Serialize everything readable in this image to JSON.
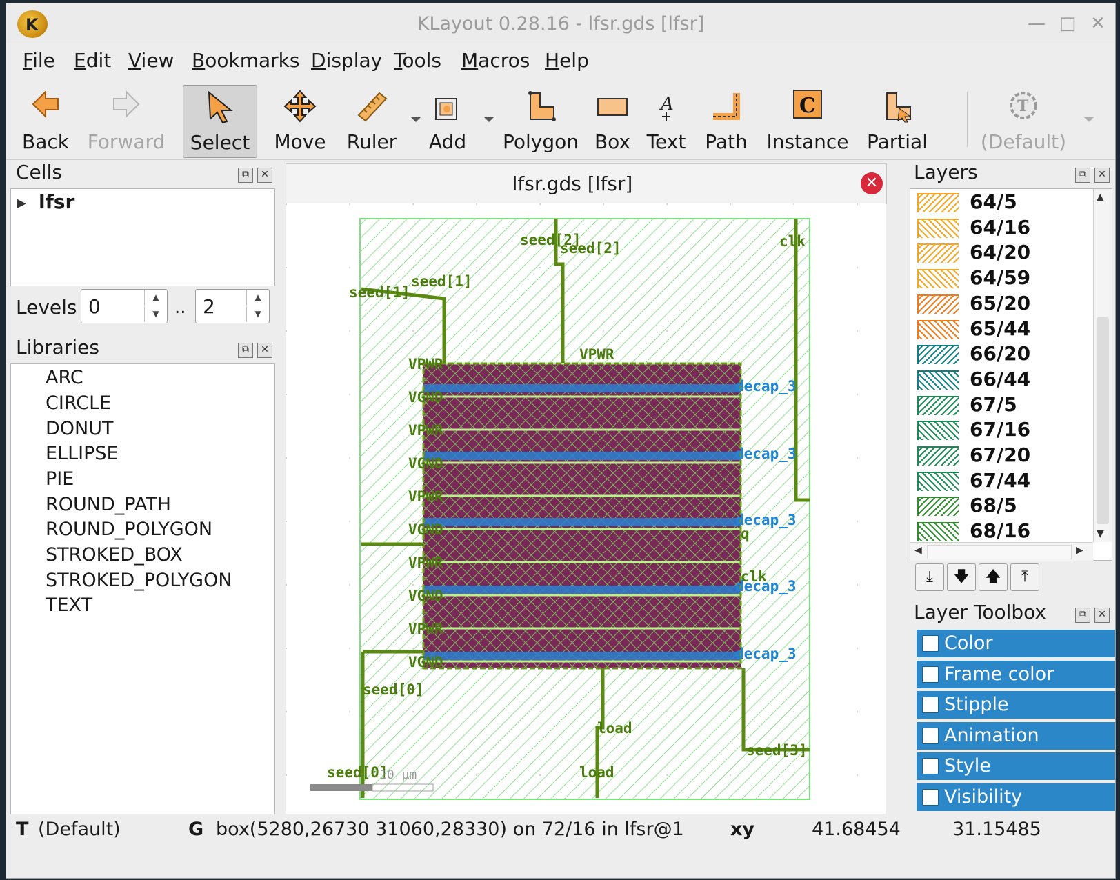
{
  "window": {
    "title": "KLayout 0.28.16 - lfsr.gds [lfsr]",
    "logo_letter": "K"
  },
  "menu": [
    {
      "label": "File",
      "u": "F",
      "rest": "ile"
    },
    {
      "label": "Edit",
      "u": "E",
      "rest": "dit"
    },
    {
      "label": "View",
      "u": "V",
      "rest": "iew"
    },
    {
      "label": "Bookmarks",
      "u": "B",
      "rest": "ookmarks"
    },
    {
      "label": "Display",
      "u": "D",
      "rest": "isplay"
    },
    {
      "label": "Tools",
      "u": "T",
      "rest": "ools"
    },
    {
      "label": "Macros",
      "u": "M",
      "rest": "acros"
    },
    {
      "label": "Help",
      "u": "H",
      "rest": "elp"
    }
  ],
  "toolbar": {
    "back": "Back",
    "forward": "Forward",
    "select": "Select",
    "move": "Move",
    "ruler": "Ruler",
    "add": "Add",
    "polygon": "Polygon",
    "box": "Box",
    "text": "Text",
    "path": "Path",
    "instance": "Instance",
    "partial": "Partial",
    "default": "(Default)"
  },
  "cells": {
    "title": "Cells",
    "root": "lfsr"
  },
  "levels": {
    "label": "Levels",
    "from": "0",
    "sep": "..",
    "to": "2"
  },
  "libraries": {
    "title": "Libraries",
    "items": [
      "ARC",
      "CIRCLE",
      "DONUT",
      "ELLIPSE",
      "PIE",
      "ROUND_PATH",
      "ROUND_POLYGON",
      "STROKED_BOX",
      "STROKED_POLYGON",
      "TEXT"
    ]
  },
  "view": {
    "tab": "lfsr.gds [lfsr]",
    "labels": {
      "seed2a": "seed[2]",
      "seed2b": "seed[2]",
      "clk": "clk",
      "seed1a": "seed[1]",
      "seed1b": "seed[1]",
      "vpwr": "VPWR",
      "seed0a": "seed[0]",
      "seed0b": "seed[0]",
      "load1": "load",
      "load2": "load",
      "seed3": "seed[3]",
      "scale": "10 µm",
      "decap1": "decap_3",
      "decap2": "decap_3",
      "decap3": "decap_3",
      "decap4": "decap_3",
      "decap5": "decap_3",
      "clk2": "clk",
      "q": "q",
      "side": [
        "VPWR",
        "VGND",
        "VPWR",
        "VGND",
        "VPWR",
        "VGND",
        "VPWR",
        "VGND",
        "VPWR",
        "VGND"
      ]
    }
  },
  "layers": {
    "title": "Layers",
    "items": [
      {
        "name": "64/5",
        "color": "#f5a623",
        "dir": "f"
      },
      {
        "name": "64/16",
        "color": "#f5a623",
        "dir": "b"
      },
      {
        "name": "64/20",
        "color": "#f5a623",
        "dir": "f"
      },
      {
        "name": "64/59",
        "color": "#f5a623",
        "dir": "b"
      },
      {
        "name": "65/20",
        "color": "#f07a1a",
        "dir": "f"
      },
      {
        "name": "65/44",
        "color": "#f07a1a",
        "dir": "b"
      },
      {
        "name": "66/20",
        "color": "#0e7f86",
        "dir": "f"
      },
      {
        "name": "66/44",
        "color": "#0e7f86",
        "dir": "b"
      },
      {
        "name": "67/5",
        "color": "#1a8a55",
        "dir": "f"
      },
      {
        "name": "67/16",
        "color": "#1a8a55",
        "dir": "b"
      },
      {
        "name": "67/20",
        "color": "#1a8a55",
        "dir": "f"
      },
      {
        "name": "67/44",
        "color": "#1a8a55",
        "dir": "b"
      },
      {
        "name": "68/5",
        "color": "#2e8b2e",
        "dir": "f"
      },
      {
        "name": "68/16",
        "color": "#2e8b2e",
        "dir": "b"
      }
    ]
  },
  "layer_toolbox": {
    "title": "Layer Toolbox",
    "items": [
      "Color",
      "Frame color",
      "Stipple",
      "Animation",
      "Style",
      "Visibility"
    ]
  },
  "status": {
    "mode_key": "T",
    "mode_val": "(Default)",
    "g_key": "G",
    "g_val": "box(5280,26730 31060,28330) on 72/16 in lfsr@1",
    "xy_key": "xy",
    "x": "41.68454",
    "y": "31.15485"
  }
}
